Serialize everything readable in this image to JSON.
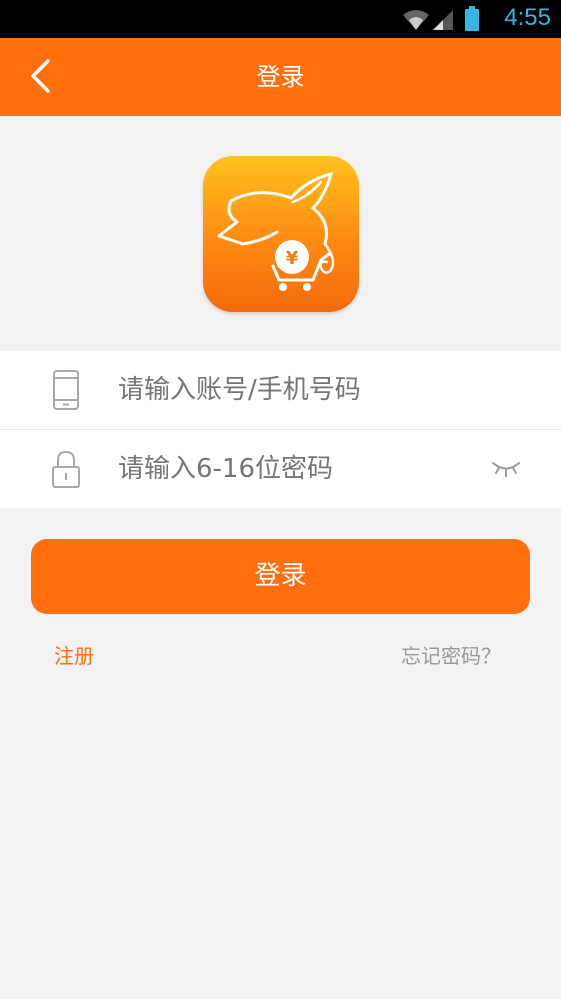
{
  "status_bar": {
    "time": "4:55",
    "icons": [
      "wifi-icon",
      "signal-icon",
      "battery-icon"
    ]
  },
  "app_bar": {
    "title": "登录",
    "back_icon": "chevron-left-icon"
  },
  "logo": {
    "icon": "pig-cart-yen-logo"
  },
  "form": {
    "account": {
      "placeholder": "请输入账号/手机号码",
      "value": "",
      "icon": "phone-icon"
    },
    "password": {
      "placeholder": "请输入6-16位密码",
      "value": "",
      "icon": "lock-icon",
      "toggle_icon": "eye-closed-icon"
    }
  },
  "login_button": "登录",
  "links": {
    "register": "注册",
    "forgot_password": "忘记密码？"
  },
  "colors": {
    "primary": "#ff6f0e",
    "background": "#f2f2f2",
    "time_blue": "#33b5e5",
    "muted_text": "#999999"
  }
}
